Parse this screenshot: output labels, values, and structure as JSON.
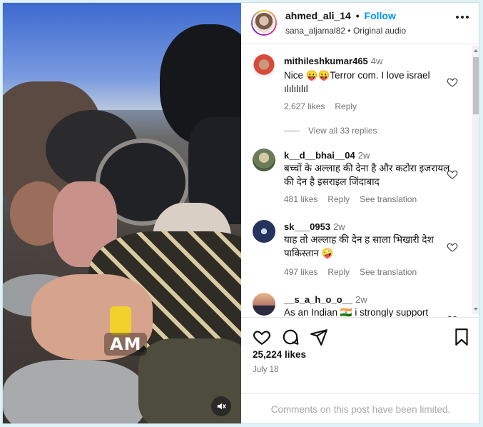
{
  "media": {
    "overlay_text": "AM",
    "mute_icon": "speaker-muted-icon"
  },
  "header": {
    "username": "ahmed_ali_14",
    "separator": "•",
    "follow_label": "Follow",
    "collaborator": "sana_aljamal82",
    "audio": "• Original audio"
  },
  "comments": [
    {
      "username": "mithileshkumar465",
      "time": "4w",
      "text": "Nice 😛😛Terror com. I love israel ılılılılıl",
      "likes": "2,627 likes",
      "reply_label": "Reply",
      "translation": "",
      "replies": "View all 33 replies"
    },
    {
      "username": "k__d__bhai__04",
      "time": "2w",
      "text": "बच्चों के अल्लाह की देना है और कटोरा इजरायल की देन है इसराइल जिंदाबाद",
      "likes": "481 likes",
      "reply_label": "Reply",
      "translation": "See translation"
    },
    {
      "username": "sk___0953",
      "time": "2w",
      "text": "याह तो अल्लाह की देन ह साला भिखारी देश पाकिस्तान 🤪",
      "likes": "497 likes",
      "reply_label": "Reply",
      "translation": "See translation"
    },
    {
      "username": "__s_a_h_o_o__",
      "time": "2w",
      "text": "As an Indian 🇮🇳 i strongly support",
      "likes": "",
      "reply_label": "",
      "translation": ""
    }
  ],
  "post": {
    "likes": "25,224 likes",
    "date": "July 18",
    "comments_limited": "Comments on this post have been limited."
  },
  "colors": {
    "follow": "#0095f6",
    "muted_text": "#737373",
    "limited_text": "#a8a8a8"
  }
}
